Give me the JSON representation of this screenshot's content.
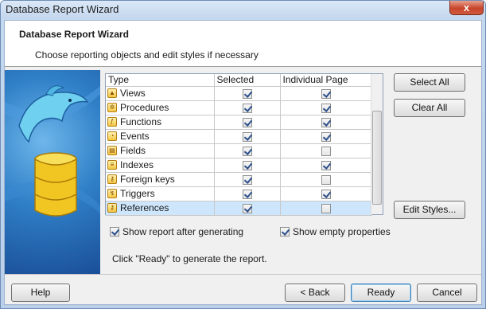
{
  "window": {
    "title": "Database Report Wizard",
    "close_label": "x"
  },
  "header": {
    "title": "Database Report Wizard",
    "subtitle": "Choose reporting objects and edit styles if necessary"
  },
  "grid": {
    "columns": [
      "Type",
      "Selected",
      "Individual Page"
    ],
    "rows": [
      {
        "type": "Views",
        "icon": "views-icon",
        "glyph": "▲",
        "selected": true,
        "individual": true
      },
      {
        "type": "Procedures",
        "icon": "procedures-icon",
        "glyph": "✲",
        "selected": true,
        "individual": true
      },
      {
        "type": "Functions",
        "icon": "functions-icon",
        "glyph": "ƒ",
        "selected": true,
        "individual": true
      },
      {
        "type": "Events",
        "icon": "events-icon",
        "glyph": "◔",
        "selected": true,
        "individual": true
      },
      {
        "type": "Fields",
        "icon": "fields-icon",
        "glyph": "▤",
        "selected": true,
        "individual": false
      },
      {
        "type": "Indexes",
        "icon": "indexes-icon",
        "glyph": "≡",
        "selected": true,
        "individual": true
      },
      {
        "type": "Foreign keys",
        "icon": "foreign-keys-icon",
        "glyph": "⚷",
        "selected": true,
        "individual": false
      },
      {
        "type": "Triggers",
        "icon": "triggers-icon",
        "glyph": "↯",
        "selected": true,
        "individual": true
      },
      {
        "type": "References",
        "icon": "references-icon",
        "glyph": "⚷",
        "selected": true,
        "individual": false
      }
    ]
  },
  "buttons": {
    "select_all": "Select All",
    "clear_all": "Clear All",
    "edit_styles": "Edit Styles...",
    "help": "Help",
    "back": "< Back",
    "ready": "Ready",
    "cancel": "Cancel"
  },
  "options": {
    "show_report": {
      "label": "Show report after generating",
      "checked": true
    },
    "show_empty": {
      "label": "Show empty properties",
      "checked": true
    }
  },
  "hint": "Click \"Ready\" to generate the report.",
  "colors": {
    "accent": "#2f7fc7",
    "selection": "#cde6fb"
  }
}
